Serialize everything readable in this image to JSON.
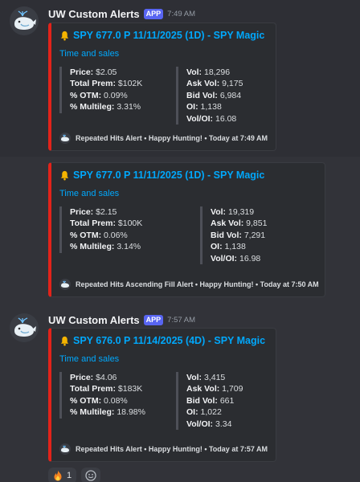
{
  "bot": {
    "name": "UW Custom Alerts",
    "badge": "APP"
  },
  "messages": [
    {
      "time": "7:49 AM",
      "embed": {
        "title": "SPY 677.0 P 11/11/2025 (1D) - SPY Magic",
        "description": "Time and sales",
        "left_fields": [
          {
            "label": "Price:",
            "value": "$2.05"
          },
          {
            "label": "Total Prem:",
            "value": "$102K"
          },
          {
            "label": "% OTM:",
            "value": "0.09%"
          },
          {
            "label": "% Multileg:",
            "value": "3.31%"
          }
        ],
        "right_fields": [
          {
            "label": "Vol:",
            "value": "18,296"
          },
          {
            "label": "Ask Vol:",
            "value": "9,175"
          },
          {
            "label": "Bid Vol:",
            "value": "6,984"
          },
          {
            "label": "OI:",
            "value": "1,138"
          },
          {
            "label": "Vol/OI:",
            "value": "16.08"
          }
        ],
        "footer": "Repeated Hits Alert • Happy Hunting! • Today at 7:49 AM"
      }
    },
    {
      "embed": {
        "title": "SPY 677.0 P 11/11/2025 (1D) - SPY Magic",
        "description": "Time and sales",
        "left_fields": [
          {
            "label": "Price:",
            "value": "$2.15"
          },
          {
            "label": "Total Prem:",
            "value": "$100K"
          },
          {
            "label": "% OTM:",
            "value": "0.06%"
          },
          {
            "label": "% Multileg:",
            "value": "3.14%"
          }
        ],
        "right_fields": [
          {
            "label": "Vol:",
            "value": "19,319"
          },
          {
            "label": "Ask Vol:",
            "value": "9,851"
          },
          {
            "label": "Bid Vol:",
            "value": "7,291"
          },
          {
            "label": "OI:",
            "value": "1,138"
          },
          {
            "label": "Vol/OI:",
            "value": "16.98"
          }
        ],
        "footer": "Repeated Hits Ascending Fill Alert • Happy Hunting! • Today at 7:50 AM"
      }
    },
    {
      "time": "7:57 AM",
      "embed": {
        "title": "SPY 676.0 P 11/14/2025 (4D) - SPY Magic",
        "description": "Time and sales",
        "left_fields": [
          {
            "label": "Price:",
            "value": "$4.06"
          },
          {
            "label": "Total Prem:",
            "value": "$183K"
          },
          {
            "label": "% OTM:",
            "value": "0.08%"
          },
          {
            "label": "% Multileg:",
            "value": "18.98%"
          }
        ],
        "right_fields": [
          {
            "label": "Vol:",
            "value": "3,415"
          },
          {
            "label": "Ask Vol:",
            "value": "1,709"
          },
          {
            "label": "Bid Vol:",
            "value": "661"
          },
          {
            "label": "OI:",
            "value": "1,022"
          },
          {
            "label": "Vol/OI:",
            "value": "3.34"
          }
        ],
        "footer": "Repeated Hits Alert • Happy Hunting! • Today at 7:57 AM"
      }
    }
  ],
  "reactions": [
    {
      "icon": "fire-icon",
      "count": "1"
    },
    {
      "icon": "add-reaction-icon",
      "count": ""
    }
  ],
  "colors": {
    "embed_border": "#e2231a",
    "link": "#00a8fc",
    "app_badge": "#5865f2"
  }
}
